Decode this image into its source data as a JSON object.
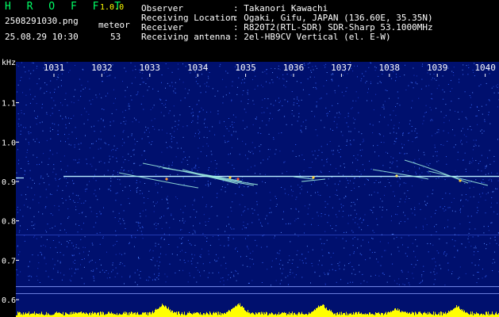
{
  "header": {
    "app_title": "H R O F F T",
    "version": "1.0.0",
    "filename": "2508291030.png",
    "datetime": "25.08.29 10:30",
    "meteor_label": "meteor",
    "meteor_count": "53",
    "info": [
      {
        "label": "Observer",
        "value": ": Takanori Kawachi"
      },
      {
        "label": "Receiving Location",
        "value": ": Ogaki, Gifu, JAPAN (136.60E, 35.35N)"
      },
      {
        "label": "Receiver",
        "value": ": R820T2(RTL-SDR) SDR-Sharp 53.1000MHz"
      },
      {
        "label": "Receiving antenna",
        "value": ": 2el-HB9CV Vertical (el. E-W)"
      }
    ]
  },
  "spectrogram": {
    "y_unit": "kHz",
    "time_ticks": [
      "1031",
      "1032",
      "1033",
      "1034",
      "1035",
      "1036",
      "1037",
      "1038",
      "1039",
      "1040"
    ],
    "freq_ticks": [
      "1.1",
      "1.0",
      "0.9",
      "0.8",
      "0.7",
      "0.6"
    ],
    "colors": {
      "background": "#00106e",
      "noise": "#3a6cff",
      "carrier": "#b8ecff",
      "trace": "#9ff0e0",
      "tick_labels": "#ffffff",
      "amplitude": "#ffff00"
    }
  }
}
